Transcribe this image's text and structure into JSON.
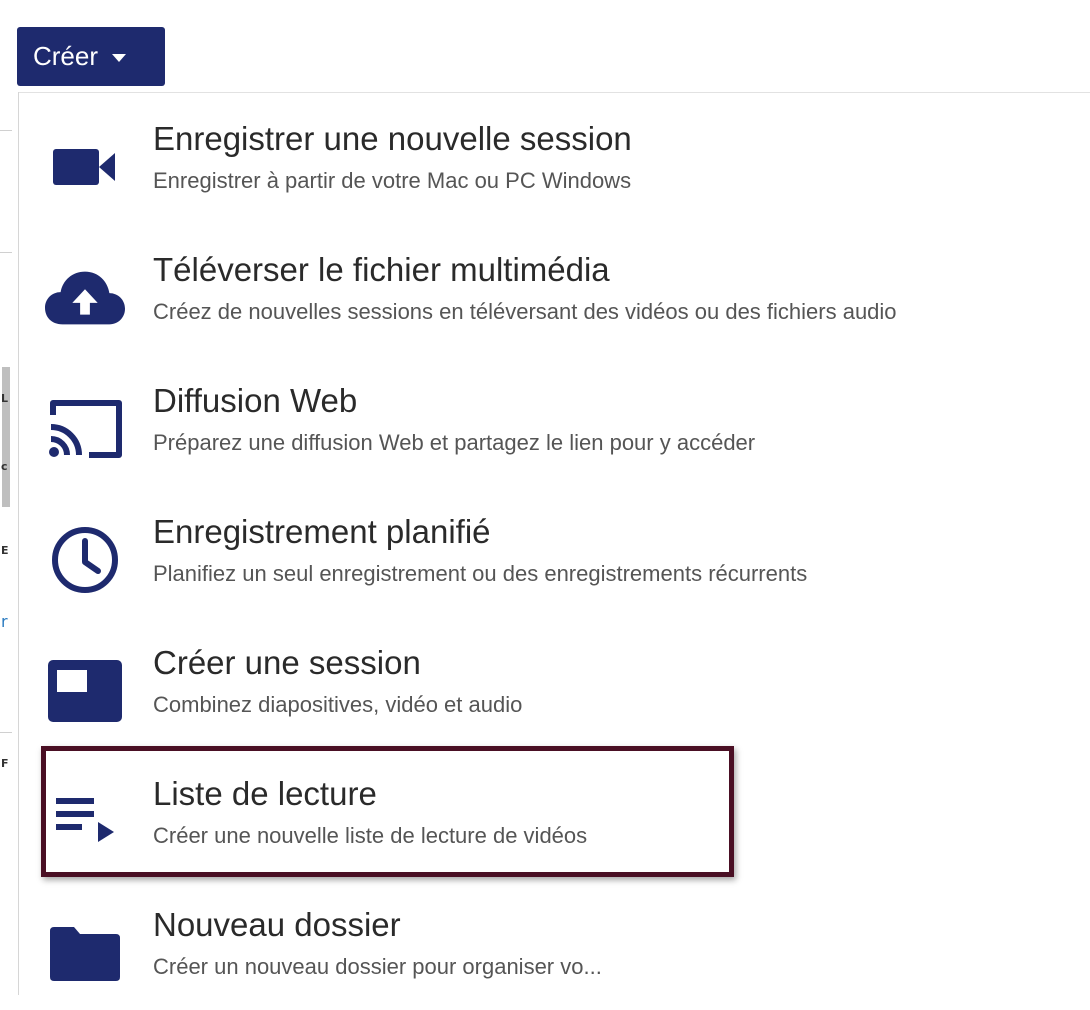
{
  "toolbar": {
    "create_label": "Créer"
  },
  "menu": {
    "items": [
      {
        "icon": "video-camera-icon",
        "title": "Enregistrer une nouvelle session",
        "description": "Enregistrer à partir de votre Mac ou PC Windows"
      },
      {
        "icon": "cloud-upload-icon",
        "title": "Téléverser le fichier multimédia",
        "description": "Créez de nouvelles sessions en téléversant des vidéos ou des fichiers audio"
      },
      {
        "icon": "cast-icon",
        "title": "Diffusion Web",
        "description": "Préparez une diffusion Web et partagez le lien pour y accéder"
      },
      {
        "icon": "clock-icon",
        "title": "Enregistrement planifié",
        "description": "Planifiez un seul enregistrement ou des enregistrements récurrents"
      },
      {
        "icon": "session-window-icon",
        "title": "Créer une session",
        "description": "Combinez diapositives, vidéo et audio"
      },
      {
        "icon": "playlist-icon",
        "title": "Liste de lecture",
        "description": "Créer une nouvelle liste de lecture de vidéos",
        "highlighted": true
      },
      {
        "icon": "folder-icon",
        "title": "Nouveau dossier",
        "description": "Créer un nouveau dossier pour organiser vo..."
      }
    ]
  },
  "colors": {
    "icon": "#1e2a6e",
    "button_bg": "#1e2a6e",
    "highlight_border": "#4a0f24"
  }
}
